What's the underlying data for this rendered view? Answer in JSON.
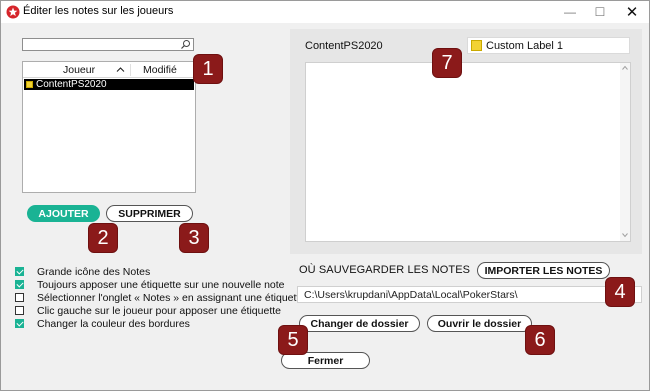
{
  "window": {
    "title": "Éditer les notes sur les joueurs",
    "minimize_glyph": "—",
    "maximize_glyph": "☐",
    "close_glyph": "✕"
  },
  "search": {
    "value": "",
    "placeholder": ""
  },
  "player_list": {
    "columns": [
      "Joueur",
      "Modifié"
    ],
    "rows": [
      {
        "name": "ContentPS2020",
        "modified": "",
        "label_color": "#f2d233"
      }
    ]
  },
  "buttons": {
    "add": "AJOUTER",
    "delete": "SUPPRIMER",
    "import": "IMPORTER LES NOTES",
    "change_folder": "Changer de dossier",
    "open_folder": "Ouvrir le dossier",
    "close": "Fermer"
  },
  "options": [
    {
      "label": "Grande icône des Notes",
      "checked": true
    },
    {
      "label": "Toujours apposer une étiquette sur une nouvelle note",
      "checked": true
    },
    {
      "label": "Sélectionner l'onglet « Notes » en assignant une étiquette",
      "checked": false
    },
    {
      "label": "Clic gauche sur le joueur pour apposer une étiquette",
      "checked": false
    },
    {
      "label": "Changer la couleur des bordures",
      "checked": true
    }
  ],
  "notes": {
    "player_name": "ContentPS2020",
    "label": "Custom Label 1",
    "label_color": "#f2d233",
    "text": ""
  },
  "save_location": {
    "heading": "OÙ SAUVEGARDER LES NOTES",
    "path": "C:\\Users\\krupdani\\AppData\\Local\\PokerStars\\"
  },
  "markers": [
    "1",
    "2",
    "3",
    "4",
    "5",
    "6",
    "7"
  ],
  "colors": {
    "accent": "#1ab394",
    "marker": "#8b1a1a",
    "window_bg": "#f0f0f0",
    "panel_bg": "#e6e6e6",
    "selection": "#000000"
  }
}
